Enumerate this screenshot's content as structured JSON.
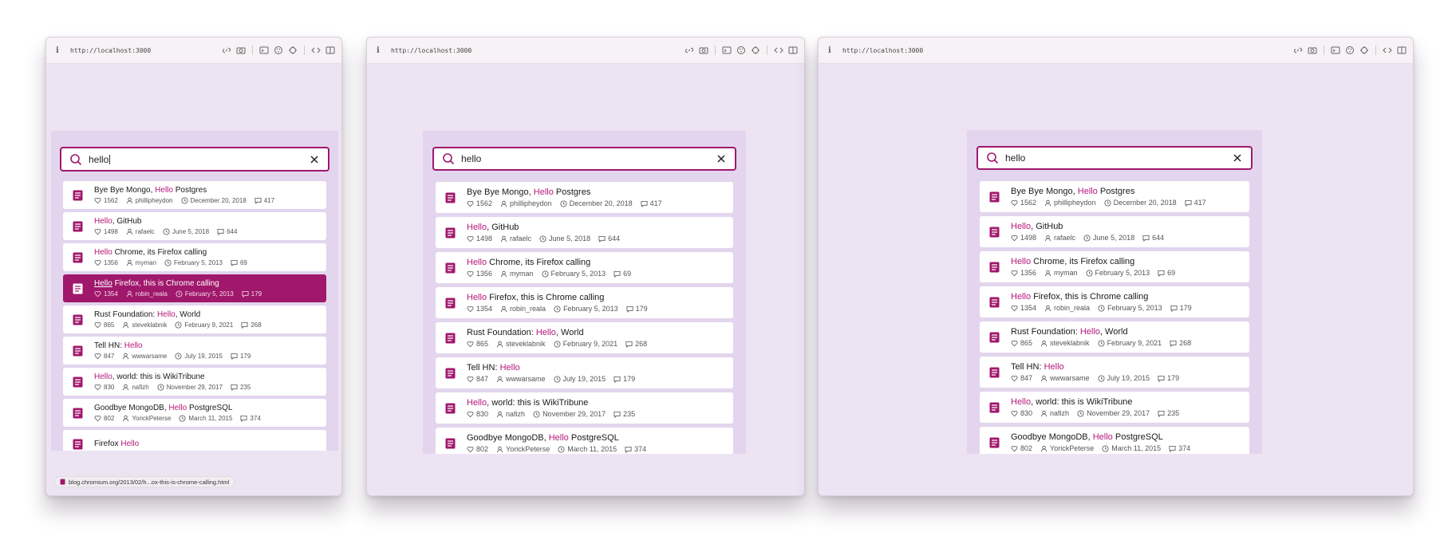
{
  "browser": {
    "url": "http://localhost:3000",
    "status_link": "blog.chromium.org/2013/02/h...ox-this-is-chrome-calling.html"
  },
  "search": {
    "value": "hello",
    "placeholder": ""
  },
  "colors": {
    "accent": "#a0186c",
    "highlight": "#b5187a",
    "panel": "#e3d5ee",
    "background": "#ece3f3"
  },
  "icons": [
    "info-icon",
    "link-icon",
    "camera-icon",
    "terminal-icon",
    "palette-icon",
    "target-icon",
    "code-icon",
    "sidebar-icon",
    "search-icon",
    "close-icon",
    "document-icon",
    "heart-icon",
    "user-icon",
    "clock-icon",
    "comment-icon"
  ],
  "results": [
    {
      "pre": "Bye Bye Mongo, ",
      "hl": "Hello",
      "post": " Postgres",
      "points": "1562",
      "author": "phillipheydon",
      "date": "December 20, 2018",
      "comments": "417"
    },
    {
      "pre": "",
      "hl": "Hello",
      "post": ", GitHub",
      "points": "1498",
      "author": "rafaelc",
      "date": "June 5, 2018",
      "comments": "644"
    },
    {
      "pre": "",
      "hl": "Hello",
      "post": " Chrome, its Firefox calling",
      "points": "1356",
      "author": "myman",
      "date": "February 5, 2013",
      "comments": "69"
    },
    {
      "pre": "",
      "hl": "Hello",
      "post": " Firefox, this is Chrome calling",
      "points": "1354",
      "author": "robin_reala",
      "date": "February 5, 2013",
      "comments": "179"
    },
    {
      "pre": "Rust Foundation: ",
      "hl": "Hello",
      "post": ", World",
      "points": "865",
      "author": "steveklabnik",
      "date": "February 9, 2021",
      "comments": "268"
    },
    {
      "pre": "Tell HN: ",
      "hl": "Hello",
      "post": "",
      "points": "847",
      "author": "wwwarsame",
      "date": "July 19, 2015",
      "comments": "179"
    },
    {
      "pre": "",
      "hl": "Hello",
      "post": ", world: this is WikiTribune",
      "points": "830",
      "author": "nafizh",
      "date": "November 29, 2017",
      "comments": "235"
    },
    {
      "pre": "Goodbye MongoDB, ",
      "hl": "Hello",
      "post": " PostgreSQL",
      "points": "802",
      "author": "YorickPeterse",
      "date": "March 11, 2015",
      "comments": "374"
    },
    {
      "pre": "Firefox ",
      "hl": "Hello",
      "post": "",
      "points": "",
      "author": "",
      "date": "",
      "comments": ""
    }
  ]
}
